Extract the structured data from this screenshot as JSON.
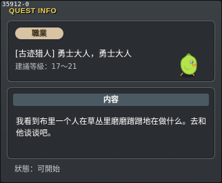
{
  "window": {
    "quest_id": "35912-0",
    "title": "QUEST INFO"
  },
  "job": {
    "tag": "職業",
    "name": "[古迹猎人] 勇士大人，勇士大人",
    "level": "建議等級：17～21",
    "mascot_icon": "green-chick-mascot-icon"
  },
  "content": {
    "header": "内容",
    "text": "我看到布里一个人在草丛里磨磨蹭蹭地在做什么。去和他谈谈吧。"
  },
  "status": {
    "text": "狀態：可開始"
  },
  "colors": {
    "title": "#f3d35a",
    "tag_background": "#d8c3a3",
    "content_header_background": "#4b5963",
    "window_background": "#33373b"
  }
}
